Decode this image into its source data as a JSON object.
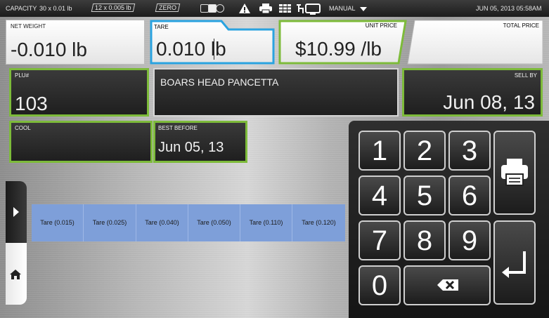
{
  "status_bar": {
    "capacity_label": "CAPACITY",
    "capacity_1": "30 x 0.01 lb",
    "capacity_2": "12 x 0.005 lb",
    "zero_label": "ZERO",
    "icons": [
      "toggle-icon",
      "warning-icon",
      "printer-icon",
      "grid-icon",
      "network-icon"
    ],
    "mode": "MANUAL",
    "datetime": "JUN 05, 2013 05:58AM"
  },
  "weights": {
    "net_weight_label": "NET WEIGHT",
    "net_weight_value": "-0.010 lb",
    "tare_label": "TARE",
    "tare_value": "0.010 lb",
    "unit_price_label": "UNIT PRICE",
    "unit_price_value": "$10.99 /lb",
    "total_price_label": "TOTAL PRICE",
    "total_price_value": ""
  },
  "item": {
    "plu_label": "PLU#",
    "plu_value": "103",
    "description": "BOARS HEAD PANCETTA",
    "sell_by_label": "SELL BY",
    "sell_by_value": "Jun 08, 13",
    "cool_label": "COOL",
    "cool_value": "",
    "best_before_label": "BEST BEFORE",
    "best_before_value": "Jun 05, 13"
  },
  "tare_presets": [
    "Tare (0.015)",
    "Tare (0.025)",
    "Tare (0.040)",
    "Tare (0.050)",
    "Tare (0.110)",
    "Tare (0.120)"
  ],
  "keypad": {
    "keys": [
      "1",
      "2",
      "3",
      "4",
      "5",
      "6",
      "7",
      "8",
      "9",
      "0"
    ],
    "backspace_icon": "backspace-icon",
    "print_icon": "printer-icon",
    "enter_icon": "enter-icon"
  },
  "colors": {
    "accent_green": "#7dbb3a",
    "tape_blue": "#2aa3e0",
    "tare_blue": "#7e9fd9"
  }
}
